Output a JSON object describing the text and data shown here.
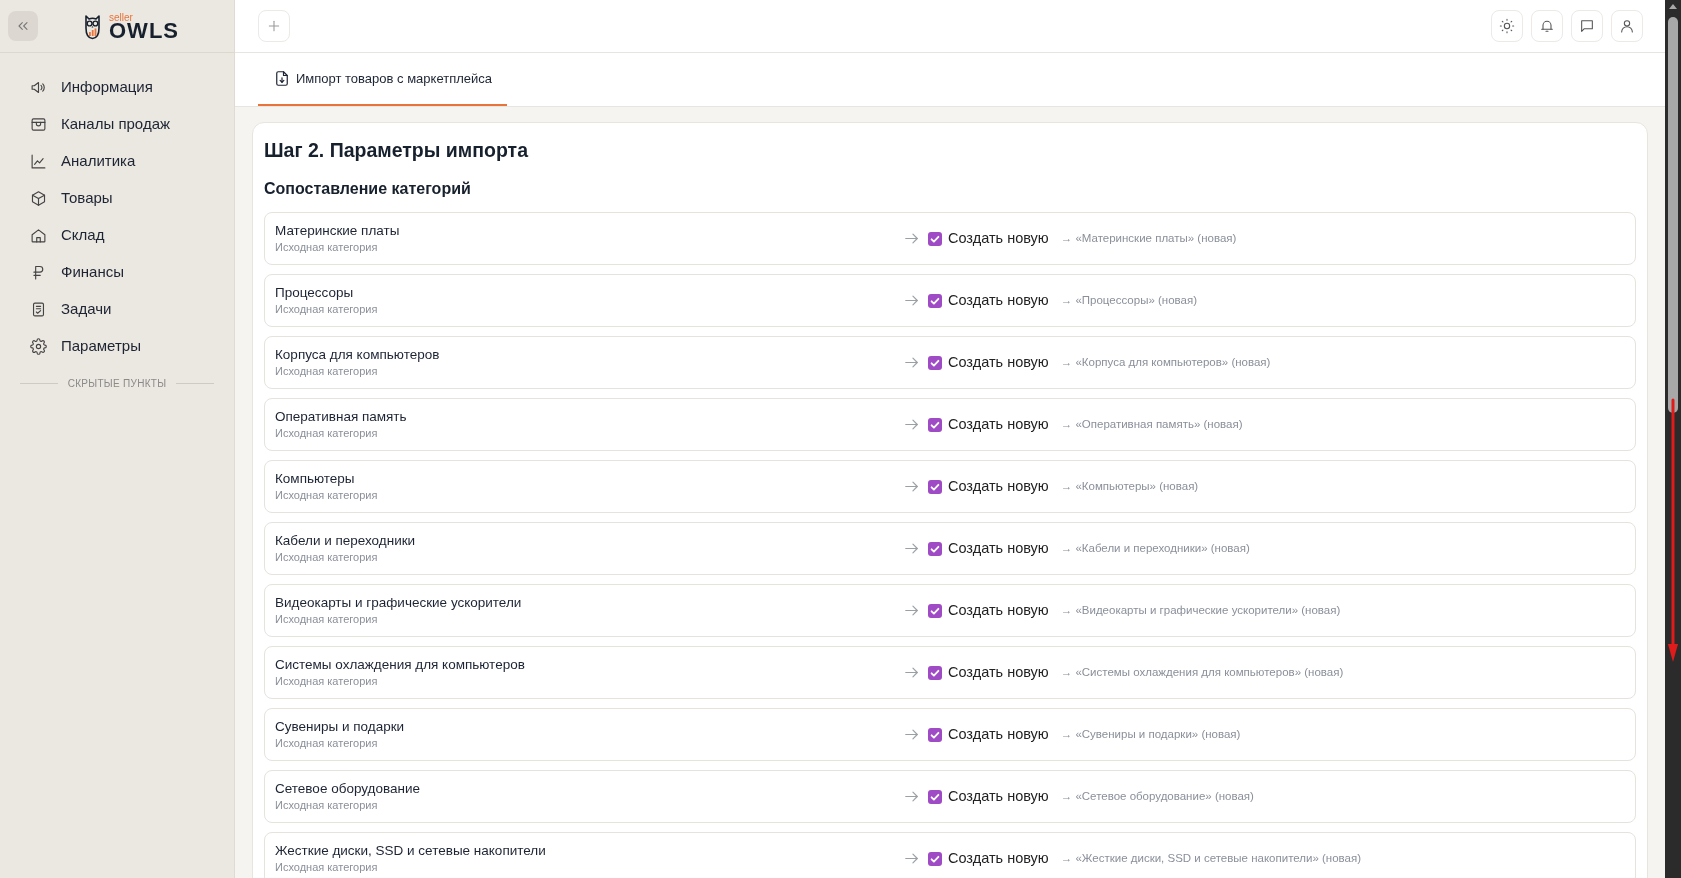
{
  "sidebar": {
    "logo": {
      "tagline": "seller",
      "name": "OWLS"
    },
    "items": [
      {
        "label": "Информация"
      },
      {
        "label": "Каналы продаж"
      },
      {
        "label": "Аналитика"
      },
      {
        "label": "Товары"
      },
      {
        "label": "Склад"
      },
      {
        "label": "Финансы"
      },
      {
        "label": "Задачи"
      },
      {
        "label": "Параметры"
      }
    ],
    "hidden_section": "СКРЫТЫЕ ПУНКТЫ"
  },
  "tabs": [
    {
      "label": "Импорт товаров с маркетплейса",
      "selected": true
    }
  ],
  "page": {
    "title": "Шаг 2. Параметры импорта",
    "section_title": "Сопоставление категорий",
    "categories": [
      {
        "name": "Материнские платы",
        "caption": "Исходная категория",
        "checked": true,
        "option": "Создать новую",
        "target": "→ «Материнские платы» (новая)"
      },
      {
        "name": "Процессоры",
        "caption": "Исходная категория",
        "checked": true,
        "option": "Создать новую",
        "target": "→ «Процессоры» (новая)"
      },
      {
        "name": "Корпуса для компьютеров",
        "caption": "Исходная категория",
        "checked": true,
        "option": "Создать новую",
        "target": "→ «Корпуса для компьютеров» (новая)"
      },
      {
        "name": "Оперативная память",
        "caption": "Исходная категория",
        "checked": true,
        "option": "Создать новую",
        "target": "→ «Оперативная память» (новая)"
      },
      {
        "name": "Компьютеры",
        "caption": "Исходная категория",
        "checked": true,
        "option": "Создать новую",
        "target": "→ «Компьютеры» (новая)"
      },
      {
        "name": "Кабели и переходники",
        "caption": "Исходная категория",
        "checked": true,
        "option": "Создать новую",
        "target": "→ «Кабели и переходники» (новая)"
      },
      {
        "name": "Видеокарты и графические ускорители",
        "caption": "Исходная категория",
        "checked": true,
        "option": "Создать новую",
        "target": "→ «Видеокарты и графические ускорители» (новая)"
      },
      {
        "name": "Системы охлаждения для компьютеров",
        "caption": "Исходная категория",
        "checked": true,
        "option": "Создать новую",
        "target": "→ «Системы охлаждения для компьютеров» (новая)"
      },
      {
        "name": "Сувениры и подарки",
        "caption": "Исходная категория",
        "checked": true,
        "option": "Создать новую",
        "target": "→ «Сувениры и подарки» (новая)"
      },
      {
        "name": "Сетевое оборудование",
        "caption": "Исходная категория",
        "checked": true,
        "option": "Создать новую",
        "target": "→ «Сетевое оборудование» (новая)"
      },
      {
        "name": "Жесткие диски, SSD и сетевые накопители",
        "caption": "Исходная категория",
        "checked": true,
        "option": "Создать новую",
        "target": "→ «Жесткие диски, SSD и сетевые накопители» (новая)"
      }
    ]
  }
}
